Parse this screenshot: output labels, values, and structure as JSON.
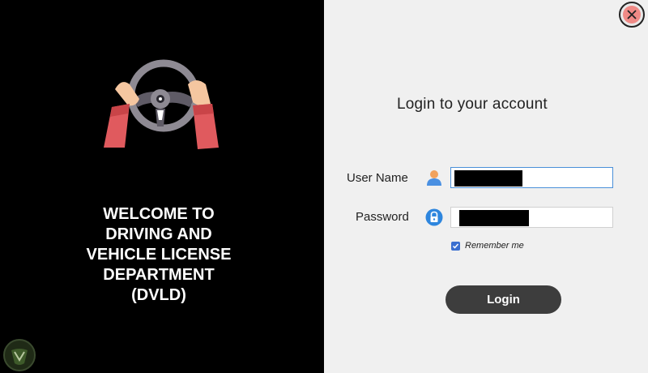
{
  "welcome_text": "WELCOME TO\nDRIVING AND\nVEHICLE LICENSE\nDEPARTMENT\n(DVLD)",
  "login": {
    "title": "Login to your account",
    "username_label": "User Name",
    "password_label": "Password",
    "remember_label": "Remember me",
    "remember_checked": true,
    "login_button": "Login"
  },
  "colors": {
    "left_background": "#000000",
    "right_background": "#f0f0f0",
    "close_button": "#f08a86",
    "login_button": "#3d3d3d",
    "checkbox": "#3a6fd0"
  },
  "icons": {
    "logo": "steering-wheel-icon",
    "username": "user-icon",
    "password": "lock-icon",
    "close": "close-icon",
    "corner": "badge-icon"
  }
}
